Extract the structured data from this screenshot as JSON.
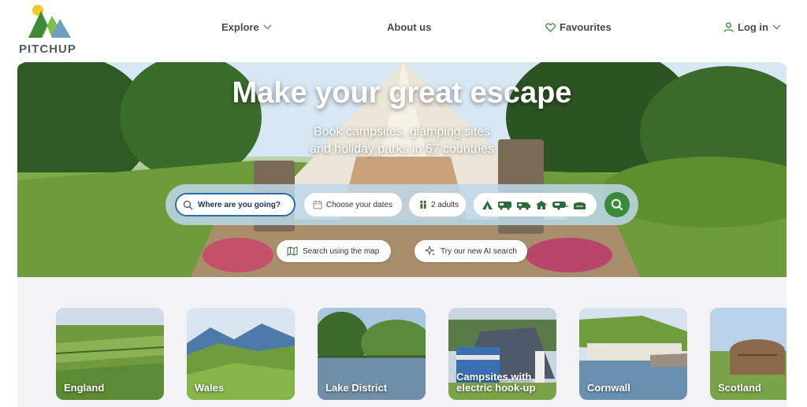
{
  "brand": {
    "name": "PITCHUP"
  },
  "nav": {
    "explore": "Explore",
    "about": "About us",
    "favourites": "Favourites",
    "login": "Log in"
  },
  "hero": {
    "title": "Make your great escape",
    "subtitle_line1": "Book campsites, glamping sites",
    "subtitle_line2": "and holiday parks in 67 countries"
  },
  "search": {
    "where": "Where are you going?",
    "dates": "Choose your dates",
    "guests": "2 adults",
    "type_icons": [
      "tent-icon",
      "campervan-icon",
      "motorhome-icon",
      "lodge-icon",
      "caravan-icon",
      "glamping-pod-icon"
    ]
  },
  "actions": {
    "map": "Search using the map",
    "ai": "Try our new AI search"
  },
  "destinations": [
    {
      "label": "England"
    },
    {
      "label": "Wales"
    },
    {
      "label": "Lake District"
    },
    {
      "label": "Campsites with electric hook-up"
    },
    {
      "label": "Cornwall"
    },
    {
      "label": "Scotland"
    }
  ],
  "colors": {
    "brand_green": "#3a8a3a",
    "search_outline": "#2e6fa8",
    "search_bar_bg": "#bed7eb",
    "nav_text": "#4a4a4a"
  }
}
